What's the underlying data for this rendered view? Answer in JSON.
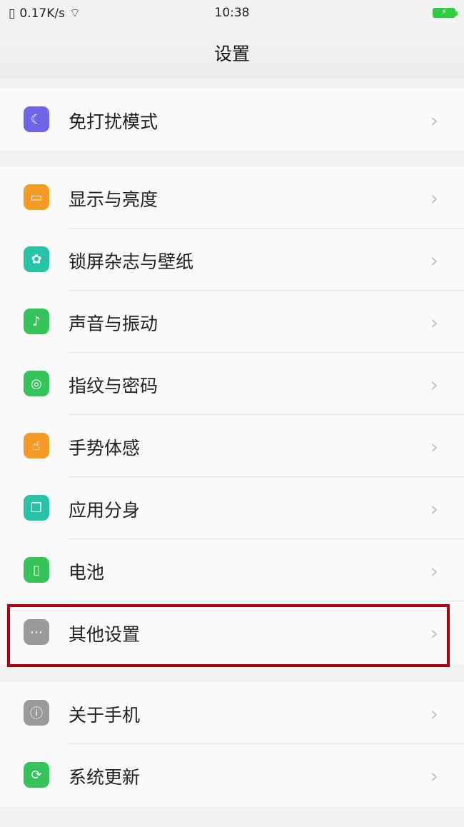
{
  "status_bar": {
    "speed": "0.17K/s",
    "time": "10:38"
  },
  "header": {
    "title": "设置"
  },
  "groups": [
    {
      "items": [
        {
          "label": "免打扰模式",
          "icon": "moon-icon",
          "color": "#6f63e8"
        }
      ]
    },
    {
      "items": [
        {
          "label": "显示与亮度",
          "icon": "monitor-icon",
          "color": "#f59a23"
        },
        {
          "label": "锁屏杂志与壁纸",
          "icon": "flower-icon",
          "color": "#27c3a6"
        },
        {
          "label": "声音与振动",
          "icon": "speaker-icon",
          "color": "#35c45a"
        },
        {
          "label": "指纹与密码",
          "icon": "fingerprint-icon",
          "color": "#35c45a"
        },
        {
          "label": "手势体感",
          "icon": "gesture-icon",
          "color": "#f59a23"
        },
        {
          "label": "应用分身",
          "icon": "clone-icon",
          "color": "#27c3a6"
        },
        {
          "label": "电池",
          "icon": "battery-icon",
          "color": "#35c45a"
        },
        {
          "label": "其他设置",
          "icon": "more-icon",
          "color": "#9a9a9a"
        }
      ]
    },
    {
      "items": [
        {
          "label": "关于手机",
          "icon": "info-icon",
          "color": "#9a9a9a"
        },
        {
          "label": "系统更新",
          "icon": "update-icon",
          "color": "#35c45a"
        }
      ]
    }
  ],
  "highlighted_item": "其他设置",
  "highlight_color": "#b00010"
}
